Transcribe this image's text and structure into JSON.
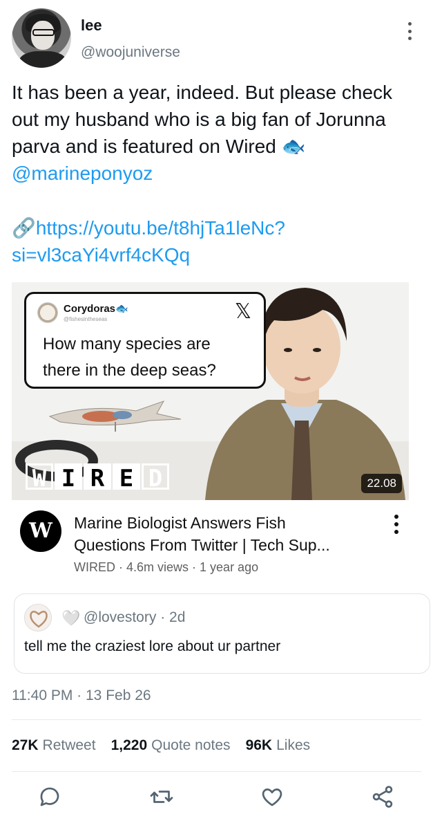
{
  "author": {
    "name": "lee",
    "handle": "@woojuniverse"
  },
  "tweet": {
    "lines": [
      "It has been a year, indeed. But please check",
      "out my husband who is a big fan of Jorunna",
      "parva and is featured on Wired 🐟"
    ],
    "mention": "@marineponyoz",
    "link_line1": "🔗https://youtu.be/t8hjTa1leNc?",
    "link_line2": "si=vl3caYi4vrf4cKQq"
  },
  "video": {
    "quote_card": {
      "name": "Corydoras🐟",
      "handle": "@fishesintheseas",
      "x_logo": "𝕏",
      "text_line1": "How many species are",
      "text_line2": "there in the deep seas?"
    },
    "wired_letters": [
      "W",
      "I",
      "R",
      "E",
      "D"
    ],
    "duration": "22.08",
    "channel_initial": "W",
    "title_line1": "Marine Biologist Answers Fish",
    "title_line2": "Questions From Twitter | Tech Sup...",
    "channel": "WIRED",
    "views": "4.6m views",
    "age": "1 year ago",
    "meta_sep": " · "
  },
  "quoted": {
    "heart": "🤍",
    "handle": "@lovestory",
    "sep": " · ",
    "age": "2d",
    "text": "tell me the craziest lore about ur partner"
  },
  "timestamp": {
    "time": "11:40 PM",
    "sep": " · ",
    "date": "13 Feb 26"
  },
  "stats": {
    "retweets_count": "27K",
    "retweets_label": "Retweet",
    "quotes_count": "1,220",
    "quotes_label": "Quote notes",
    "likes_count": "96K",
    "likes_label": "Likes"
  },
  "colors": {
    "link": "#1d9bf0",
    "secondary_text": "#6b7780",
    "divider": "#e6e9eb"
  },
  "icons": [
    "reply-icon",
    "retweet-icon",
    "like-icon",
    "share-icon",
    "more-icon"
  ]
}
